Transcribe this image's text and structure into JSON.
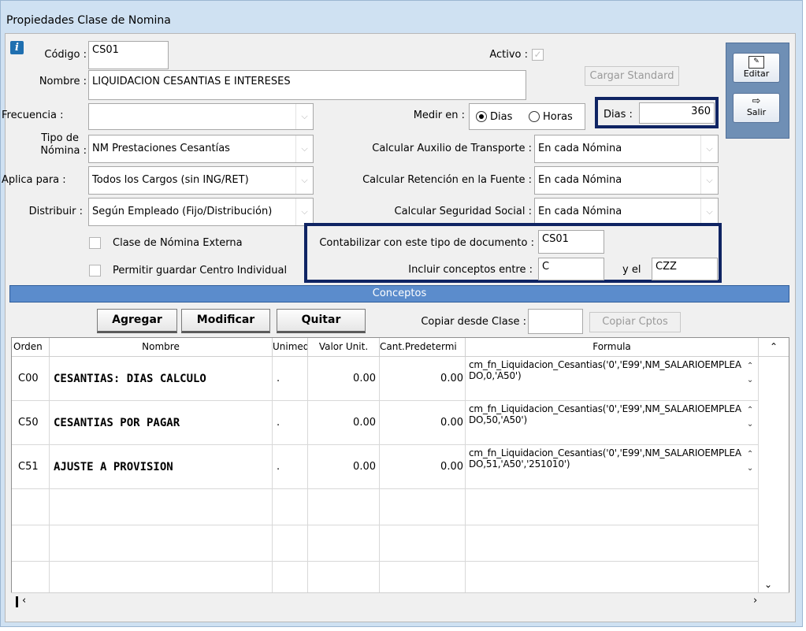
{
  "window": {
    "title": "Propiedades Clase de Nomina"
  },
  "form": {
    "codigo_label": "Código :",
    "codigo_value": "CS01",
    "activo_label": "Activo :",
    "activo_check": "✓",
    "nombre_label": "Nombre :",
    "nombre_value": "LIQUIDACION CESANTIAS E INTERESES",
    "cargar_standard": "Cargar Standard",
    "frecuencia_label": "Frecuencia :",
    "frecuencia_value": "",
    "medir_label": "Medir en :",
    "medir_options": [
      "Dias",
      "Horas"
    ],
    "medir_selected": "Dias",
    "dias_label": "Dias :",
    "dias_value": "360",
    "tipo_label_1": "Tipo de",
    "tipo_label_2": "Nómina :",
    "tipo_value": "NM Prestaciones Cesantías",
    "auxilio_label": "Calcular Auxilio de Transporte :",
    "auxilio_value": "En cada Nómina",
    "aplica_label": "Aplica para :",
    "aplica_value": "Todos los Cargos (sin ING/RET)",
    "retencion_label": "Calcular Retención en la Fuente :",
    "retencion_value": "En cada Nómina",
    "distribuir_label": "Distribuir :",
    "distribuir_value": "Según Empleado (Fijo/Distribución)",
    "seguridad_label": "Calcular Seguridad Social :",
    "seguridad_value": "En cada Nómina",
    "externa_label": "Clase de Nómina Externa",
    "centro_label": "Permitir guardar Centro Individual",
    "contabilizar_label": "Contabilizar con este tipo de documento :",
    "contabilizar_value": "CS01",
    "incluir_label": "Incluir conceptos entre :",
    "incluir_from": "C",
    "incluir_y_label": "y el",
    "incluir_to": "CZZ"
  },
  "sidebar": {
    "editar": "Editar",
    "salir": "Salir"
  },
  "conceptos": {
    "title": "Conceptos",
    "agregar": "Agregar",
    "modificar": "Modificar",
    "quitar": "Quitar",
    "copiar_label": "Copiar desde Clase :",
    "copiar_value": "",
    "copiar_btn": "Copiar Cptos"
  },
  "grid": {
    "columns": [
      "Orden",
      "Nombre",
      "Unimed",
      "Valor Unit.",
      "Cant.Predetermi",
      "Formula"
    ],
    "rows": [
      {
        "orden": "C00",
        "nombre": "CESANTIAS: DIAS CALCULO",
        "unimed": ".",
        "valor": "0.00",
        "cant": "0.00",
        "formula": "cm_fn_Liquidacion_Cesantias('0','E99',NM_SALARIOEMPLEADO,0,'A50')"
      },
      {
        "orden": "C50",
        "nombre": "CESANTIAS POR PAGAR",
        "unimed": ".",
        "valor": "0.00",
        "cant": "0.00",
        "formula": "cm_fn_Liquidacion_Cesantias('0','E99',NM_SALARIOEMPLEADO,50,'A50')"
      },
      {
        "orden": "C51",
        "nombre": "AJUSTE A PROVISION",
        "unimed": ".",
        "valor": "0.00",
        "cant": "0.00",
        "formula": "cm_fn_Liquidacion_Cesantias('0','E99',NM_SALARIOEMPLEADO,51,'A50','251010')"
      }
    ]
  }
}
